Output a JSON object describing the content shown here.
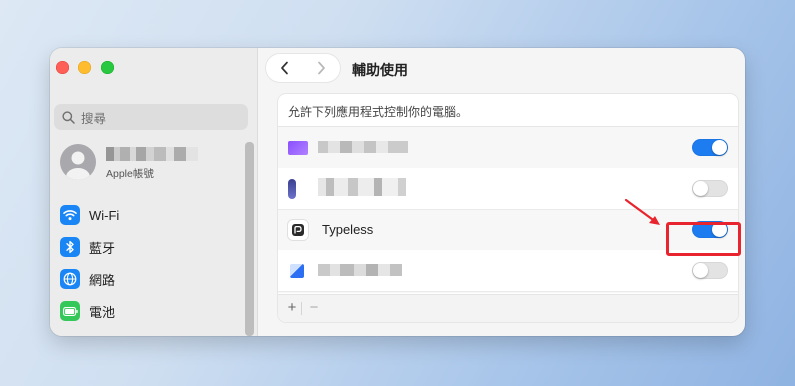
{
  "window": {
    "title": "輔助使用"
  },
  "sidebar": {
    "search_placeholder": "搜尋",
    "account": {
      "name": "",
      "subtitle": "Apple帳號"
    },
    "items": [
      {
        "label": "Wi-Fi",
        "icon": "wifi-icon",
        "color": "#1a86f5"
      },
      {
        "label": "藍牙",
        "icon": "bluetooth-icon",
        "color": "#1a86f5"
      },
      {
        "label": "網路",
        "icon": "globe-icon",
        "color": "#1a86f5"
      },
      {
        "label": "電池",
        "icon": "battery-icon",
        "color": "#34c759"
      }
    ]
  },
  "panel": {
    "heading": "允許下列應用程式控制你的電腦。",
    "apps": [
      {
        "name": "",
        "enabled": true
      },
      {
        "name": "",
        "enabled": false
      },
      {
        "name": "Typeless",
        "enabled": true
      },
      {
        "name": "",
        "enabled": false
      }
    ],
    "add_label": "+",
    "remove_label": "−"
  },
  "colors": {
    "toggle_on": "#1d7cf0",
    "highlight": "#e8252f"
  }
}
